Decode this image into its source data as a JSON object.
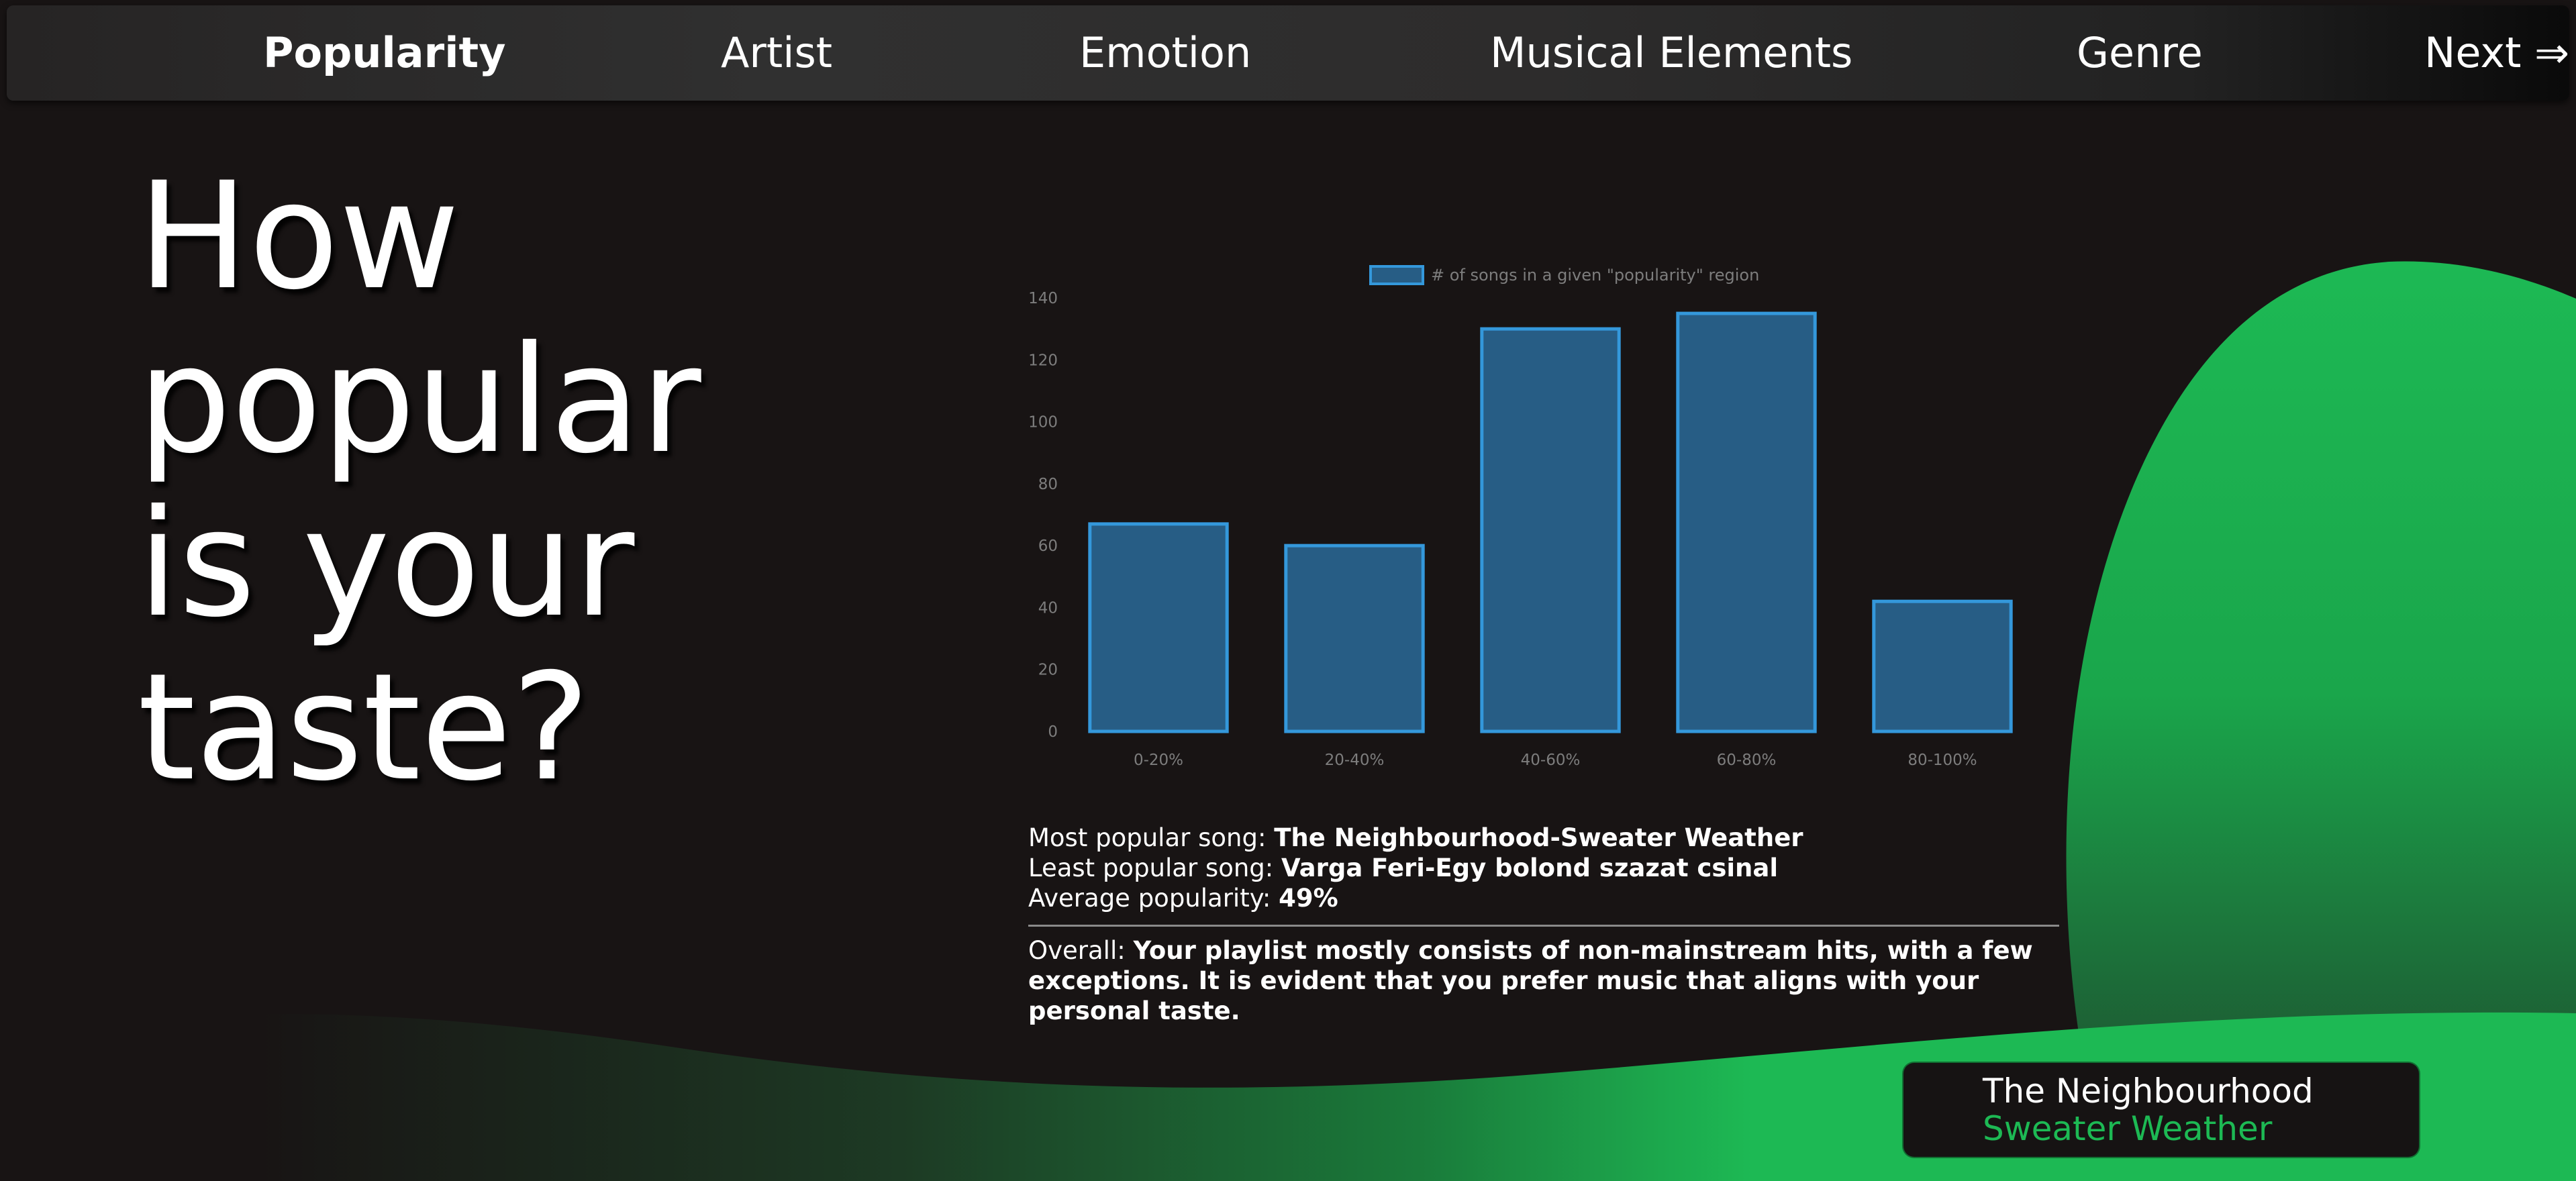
{
  "nav": {
    "items": [
      {
        "label": "Popularity",
        "active": true
      },
      {
        "label": "Artist",
        "active": false
      },
      {
        "label": "Emotion",
        "active": false
      },
      {
        "label": "Musical Elements",
        "active": false
      },
      {
        "label": "Genre",
        "active": false
      }
    ],
    "next_label": "Next ⇒"
  },
  "headline": "How popular is your taste?",
  "chart_data": {
    "type": "bar",
    "legend": "# of songs in a given \"popularity\" region",
    "legend_placement": "top-center",
    "categories": [
      "0-20%",
      "20-40%",
      "40-60%",
      "60-80%",
      "80-100%"
    ],
    "values": [
      67,
      60,
      130,
      135,
      42
    ],
    "ylim": [
      0,
      140
    ],
    "yticks": [
      0,
      20,
      40,
      60,
      80,
      100,
      120,
      140
    ],
    "grid": false,
    "bar_fill": "#275d85",
    "bar_stroke": "#3498db"
  },
  "stats": {
    "most_label": "Most popular song:",
    "most_value": "The Neighbourhood-Sweater Weather",
    "least_label": "Least popular song:",
    "least_value": "Varga Feri-Egy bolond szazat csinal",
    "avg_label": "Average popularity:",
    "avg_value": "49%"
  },
  "overall": {
    "label": "Overall:",
    "text": "Your playlist mostly consists of non-mainstream hits, with a few exceptions. It is evident that you prefer music that aligns with your personal taste."
  },
  "now_playing": {
    "artist": "The Neighbourhood",
    "song": "Sweater Weather"
  },
  "colors": {
    "accent_green": "#1db954",
    "background": "#181414"
  }
}
